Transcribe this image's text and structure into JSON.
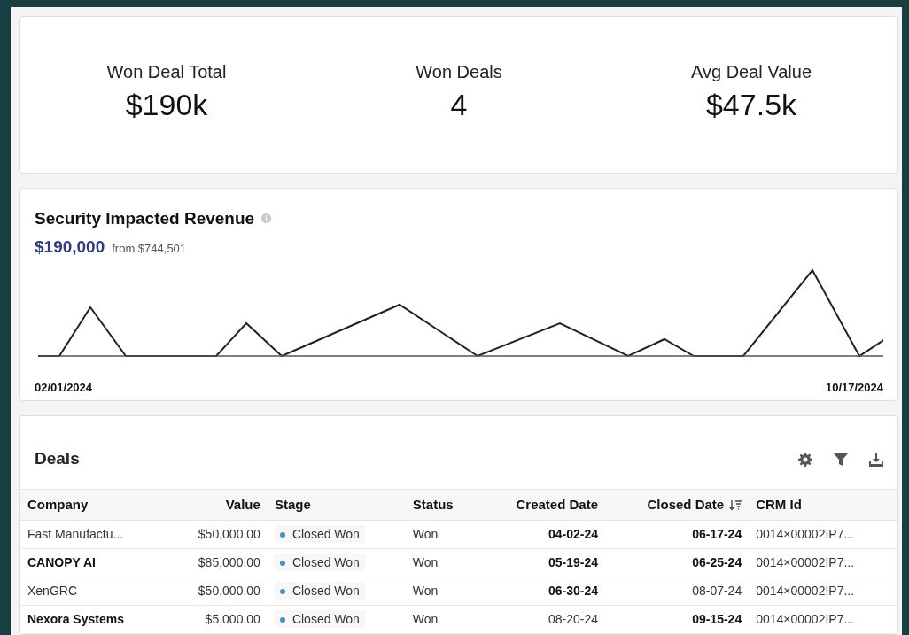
{
  "kpis": [
    {
      "label": "Won Deal Total",
      "value": "$190k"
    },
    {
      "label": "Won Deals",
      "value": "4"
    },
    {
      "label": "Avg Deal Value",
      "value": "$47.5k"
    }
  ],
  "revenue": {
    "title": "Security Impacted Revenue",
    "amount": "$190,000",
    "from": "from $744,501",
    "start_date": "02/01/2024",
    "end_date": "10/17/2024"
  },
  "deals": {
    "title": "Deals",
    "columns": [
      {
        "label": "Company",
        "sorted": false
      },
      {
        "label": "Value",
        "sorted": false
      },
      {
        "label": "Stage",
        "sorted": false
      },
      {
        "label": "Status",
        "sorted": false
      },
      {
        "label": "Created Date",
        "sorted": false
      },
      {
        "label": "Closed Date",
        "sorted": true
      },
      {
        "label": "CRM Id",
        "sorted": false
      }
    ],
    "rows": [
      {
        "cells": [
          {
            "text": "Fast Manufactu...",
            "bold": false
          },
          {
            "text": "$50,000.00",
            "bold": false
          },
          {
            "text": "Closed Won",
            "bold": false
          },
          {
            "text": "Won",
            "bold": false
          },
          {
            "text": "04-02-24",
            "bold": true
          },
          {
            "text": "06-17-24",
            "bold": true
          },
          {
            "text": "0014×00002IP7...",
            "bold": false
          }
        ]
      },
      {
        "cells": [
          {
            "text": "CANOPY AI",
            "bold": true
          },
          {
            "text": "$85,000.00",
            "bold": false
          },
          {
            "text": "Closed Won",
            "bold": false
          },
          {
            "text": "Won",
            "bold": false
          },
          {
            "text": "05-19-24",
            "bold": true
          },
          {
            "text": "06-25-24",
            "bold": true
          },
          {
            "text": "0014×00002IP7...",
            "bold": false
          }
        ]
      },
      {
        "cells": [
          {
            "text": "XenGRC",
            "bold": false
          },
          {
            "text": "$50,000.00",
            "bold": false
          },
          {
            "text": "Closed Won",
            "bold": false
          },
          {
            "text": "Won",
            "bold": false
          },
          {
            "text": "06-30-24",
            "bold": true
          },
          {
            "text": "08-07-24",
            "bold": false
          },
          {
            "text": "0014×00002IP7...",
            "bold": false
          }
        ]
      },
      {
        "cells": [
          {
            "text": "Nexora Systems",
            "bold": true
          },
          {
            "text": "$5,000.00",
            "bold": false
          },
          {
            "text": "Closed Won",
            "bold": false
          },
          {
            "text": "Won",
            "bold": false
          },
          {
            "text": "08-20-24",
            "bold": false
          },
          {
            "text": "09-15-24",
            "bold": true
          },
          {
            "text": "0014×00002IP7...",
            "bold": false
          }
        ]
      }
    ]
  }
}
